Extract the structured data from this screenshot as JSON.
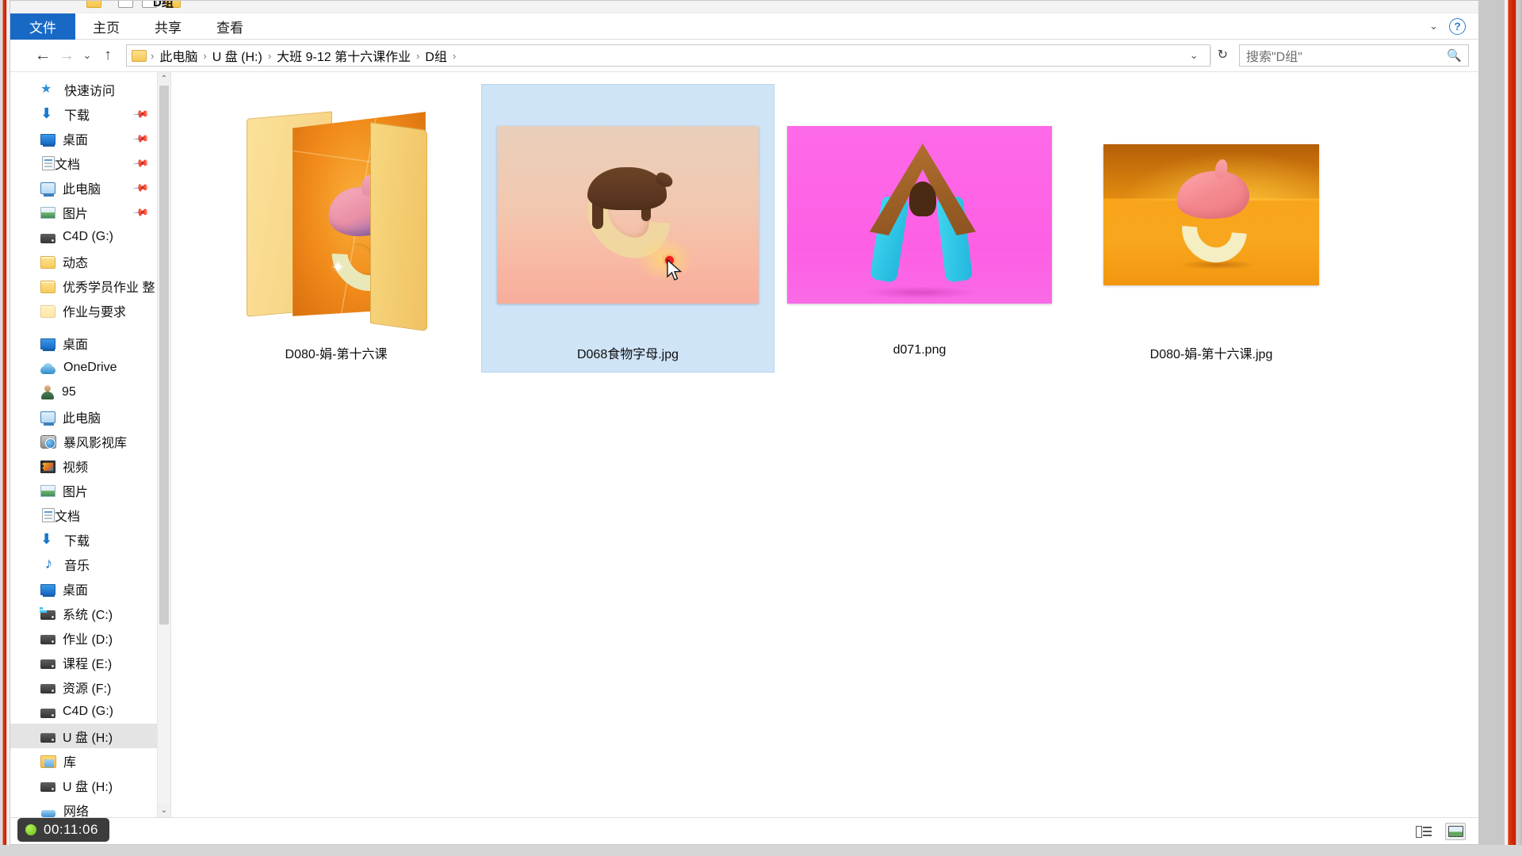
{
  "window": {
    "title_fragment": "D组",
    "tabs": [
      {
        "label": "文件",
        "id": "file"
      },
      {
        "label": "主页",
        "id": "home"
      },
      {
        "label": "共享",
        "id": "share"
      },
      {
        "label": "查看",
        "id": "view"
      }
    ],
    "ribbon_collapse_icon": "chevron-down-icon",
    "help_icon": "?"
  },
  "address": {
    "back_icon": "←",
    "forward_icon": "→",
    "history_icon": "⌄",
    "up_icon": "↑",
    "separator": "›",
    "crumbs": [
      "此电脑",
      "U 盘 (H:)",
      "大班 9-12 第十六课作业",
      "D组"
    ],
    "dropdown_icon": "⌄",
    "refresh_icon": "↻"
  },
  "search": {
    "placeholder": "搜索\"D组\"",
    "icon": "search-icon"
  },
  "sidebar": {
    "groups": [
      {
        "header": {
          "label": "快速访问",
          "icon": "star-icon",
          "depth": 0
        },
        "items": [
          {
            "label": "下载",
            "icon": "download-icon",
            "pinned": true,
            "depth": 1
          },
          {
            "label": "桌面",
            "icon": "desktop-icon",
            "pinned": true,
            "depth": 1
          },
          {
            "label": "文档",
            "icon": "document-icon",
            "pinned": true,
            "depth": 1
          },
          {
            "label": "此电脑",
            "icon": "computer-icon",
            "pinned": true,
            "depth": 1
          },
          {
            "label": "图片",
            "icon": "pictures-icon",
            "pinned": true,
            "depth": 1
          },
          {
            "label": "C4D (G:)",
            "icon": "drive-icon",
            "pinned": false,
            "depth": 1
          },
          {
            "label": "动态",
            "icon": "folder-icon",
            "pinned": false,
            "depth": 1
          },
          {
            "label": "优秀学员作业 整",
            "icon": "folder-icon",
            "pinned": false,
            "depth": 1
          },
          {
            "label": "作业与要求",
            "icon": "folder-pale-icon",
            "pinned": false,
            "depth": 1
          }
        ]
      },
      {
        "header": null,
        "items": [
          {
            "label": "桌面",
            "icon": "desktop-icon",
            "pinned": false,
            "depth": 0
          },
          {
            "label": "OneDrive",
            "icon": "onedrive-icon",
            "pinned": false,
            "depth": 0
          },
          {
            "label": "95",
            "icon": "user-icon",
            "pinned": false,
            "depth": 0
          },
          {
            "label": "此电脑",
            "icon": "computer-icon",
            "pinned": false,
            "depth": 0
          },
          {
            "label": "暴风影视库",
            "icon": "media-library-icon",
            "pinned": false,
            "depth": 1
          },
          {
            "label": "视频",
            "icon": "video-icon",
            "pinned": false,
            "depth": 1
          },
          {
            "label": "图片",
            "icon": "pictures-icon",
            "pinned": false,
            "depth": 1
          },
          {
            "label": "文档",
            "icon": "document-icon",
            "pinned": false,
            "depth": 1
          },
          {
            "label": "下载",
            "icon": "download-icon",
            "pinned": false,
            "depth": 1
          },
          {
            "label": "音乐",
            "icon": "music-icon",
            "pinned": false,
            "depth": 1
          },
          {
            "label": "桌面",
            "icon": "desktop-icon",
            "pinned": false,
            "depth": 1
          },
          {
            "label": "系统 (C:)",
            "icon": "system-drive-icon",
            "pinned": false,
            "depth": 1
          },
          {
            "label": "作业 (D:)",
            "icon": "drive-icon",
            "pinned": false,
            "depth": 1
          },
          {
            "label": "课程 (E:)",
            "icon": "drive-icon",
            "pinned": false,
            "depth": 1
          },
          {
            "label": "资源 (F:)",
            "icon": "drive-icon",
            "pinned": false,
            "depth": 1
          },
          {
            "label": "C4D (G:)",
            "icon": "drive-icon",
            "pinned": false,
            "depth": 1
          },
          {
            "label": "U 盘 (H:)",
            "icon": "drive-icon",
            "pinned": false,
            "depth": 1,
            "selected": true
          },
          {
            "label": "库",
            "icon": "library-icon",
            "pinned": false,
            "depth": 0
          },
          {
            "label": "U 盘 (H:)",
            "icon": "drive-icon",
            "pinned": false,
            "depth": 0
          },
          {
            "label": "网络",
            "icon": "network-icon",
            "pinned": false,
            "depth": 0
          }
        ]
      }
    ],
    "scrollbar": {
      "up_arrow": "⌃",
      "down_arrow": "⌄"
    }
  },
  "files": [
    {
      "name": "D080-娟-第十六课",
      "kind": "folder",
      "selected": false
    },
    {
      "name": "D068食物字母.jpg",
      "kind": "image",
      "selected": true
    },
    {
      "name": "d071.png",
      "kind": "image",
      "selected": false
    },
    {
      "name": "D080-娟-第十六课.jpg",
      "kind": "image",
      "selected": false
    }
  ],
  "statusbar": {
    "details_view_icon": "details-view-icon",
    "thumbnail_view_icon": "thumbnail-view-icon"
  },
  "recording": {
    "time": "00:11:06",
    "indicator": "recording-dot"
  },
  "colors": {
    "accent": "#1869c5",
    "selection": "#cfe4f7",
    "nav_selected": "#e4e4e4",
    "record_border": "#c41d06",
    "record_dot": "#5fbf16"
  }
}
